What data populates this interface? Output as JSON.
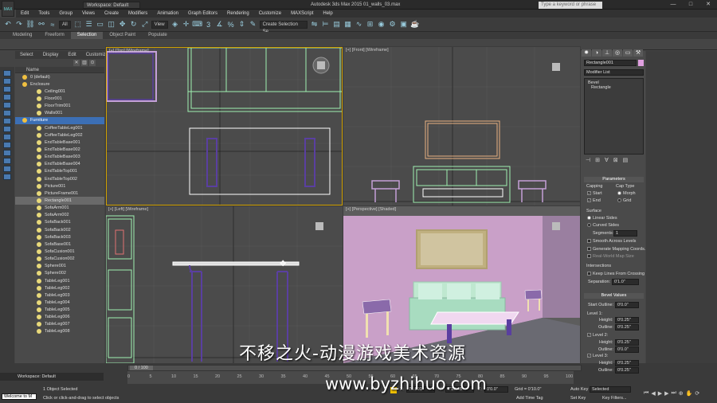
{
  "app": {
    "logo": "MAX",
    "workspace": "Workspace: Default",
    "title": "Autodesk 3ds Max 2015    01_walls_03.max",
    "search_placeholder": "Type a keyword or phrase"
  },
  "window_buttons": [
    "minimize-icon",
    "maximize-icon",
    "close-icon"
  ],
  "menu": [
    "Edit",
    "Tools",
    "Group",
    "Views",
    "Create",
    "Modifiers",
    "Animation",
    "Graph Editors",
    "Rendering",
    "Customize",
    "MAXScript",
    "Help"
  ],
  "toolbar": {
    "filter": "All",
    "selection_set": "Create Selection Se",
    "view_label": "View"
  },
  "ribbon": {
    "tabs": [
      "Modeling",
      "Freeform",
      "Selection",
      "Object Paint",
      "Populate"
    ],
    "active": "Selection"
  },
  "scene_explorer": {
    "menus": [
      "Select",
      "Display",
      "Edit",
      "Customize"
    ],
    "column_header": "Name",
    "items": [
      {
        "label": "0 (default)",
        "indent": 1,
        "state": "normal"
      },
      {
        "label": "Enclosure",
        "indent": 1,
        "state": "normal"
      },
      {
        "label": "Ceiling001",
        "indent": 3,
        "state": "normal"
      },
      {
        "label": "Floor001",
        "indent": 3,
        "state": "normal"
      },
      {
        "label": "FloorTrim001",
        "indent": 3,
        "state": "normal"
      },
      {
        "label": "Walls001",
        "indent": 3,
        "state": "normal"
      },
      {
        "label": "Furniture",
        "indent": 1,
        "state": "selected"
      },
      {
        "label": "CoffeeTableLeg001",
        "indent": 3,
        "state": "normal"
      },
      {
        "label": "CoffeeTableLeg002",
        "indent": 3,
        "state": "normal"
      },
      {
        "label": "EndTableBase001",
        "indent": 3,
        "state": "normal"
      },
      {
        "label": "EndTableBase002",
        "indent": 3,
        "state": "normal"
      },
      {
        "label": "EndTableBase003",
        "indent": 3,
        "state": "normal"
      },
      {
        "label": "EndTableBase004",
        "indent": 3,
        "state": "normal"
      },
      {
        "label": "EndTableTop001",
        "indent": 3,
        "state": "normal"
      },
      {
        "label": "EndTableTop002",
        "indent": 3,
        "state": "normal"
      },
      {
        "label": "Picture001",
        "indent": 3,
        "state": "normal"
      },
      {
        "label": "PictureFrame001",
        "indent": 3,
        "state": "normal"
      },
      {
        "label": "Rectangle001",
        "indent": 3,
        "state": "hover"
      },
      {
        "label": "SofaArm001",
        "indent": 3,
        "state": "normal"
      },
      {
        "label": "SofaArm002",
        "indent": 3,
        "state": "normal"
      },
      {
        "label": "SofaBack001",
        "indent": 3,
        "state": "normal"
      },
      {
        "label": "SofaBack002",
        "indent": 3,
        "state": "normal"
      },
      {
        "label": "SofaBack003",
        "indent": 3,
        "state": "normal"
      },
      {
        "label": "SofaBase001",
        "indent": 3,
        "state": "normal"
      },
      {
        "label": "SofaCusion001",
        "indent": 3,
        "state": "normal"
      },
      {
        "label": "SofaCusion002",
        "indent": 3,
        "state": "normal"
      },
      {
        "label": "Sphere001",
        "indent": 3,
        "state": "normal"
      },
      {
        "label": "Sphere002",
        "indent": 3,
        "state": "normal"
      },
      {
        "label": "TableLeg001",
        "indent": 3,
        "state": "normal"
      },
      {
        "label": "TableLeg002",
        "indent": 3,
        "state": "normal"
      },
      {
        "label": "TableLeg003",
        "indent": 3,
        "state": "normal"
      },
      {
        "label": "TableLeg004",
        "indent": 3,
        "state": "normal"
      },
      {
        "label": "TableLeg005",
        "indent": 3,
        "state": "normal"
      },
      {
        "label": "TableLeg006",
        "indent": 3,
        "state": "normal"
      },
      {
        "label": "TableLeg007",
        "indent": 3,
        "state": "normal"
      },
      {
        "label": "TableLeg008",
        "indent": 3,
        "state": "normal"
      }
    ],
    "workspace_footer": "Workspace: Default"
  },
  "viewports": {
    "top": "[+] [Top] [Wireframe]",
    "front": "[+] [Front] [Wireframe]",
    "left": "[+] [Left] [Wireframe]",
    "perspective": "[+] [Perspective] [Shaded]"
  },
  "command_panel": {
    "object_name": "Rectangle001",
    "modifier_list": "Modifier List",
    "stack": [
      "Bevel",
      "Rectangle"
    ],
    "parameters": {
      "title": "Parameters",
      "capping_label": "Capping",
      "cap_type_label": "Cap Type",
      "start": "Start",
      "end": "End",
      "morph": "Morph",
      "grid": "Grid",
      "surface_label": "Surface",
      "linear_sides": "Linear Sides",
      "curved_sides": "Curved Sides",
      "segments_label": "Segments:",
      "segments_value": "1",
      "smooth": "Smooth Across Levels",
      "gen_mapping": "Generate Mapping Coords.",
      "real_world": "Real-World Map Size",
      "intersections_label": "Intersections",
      "keep_lines": "Keep Lines From Crossing",
      "separation_label": "Separation:",
      "separation_value": "0'1.0\""
    },
    "bevel_values": {
      "title": "Bevel Values",
      "start_outline_label": "Start Outline:",
      "start_outline": "0'0.0\"",
      "level1": "Level 1:",
      "level1_height": "0'0.25\"",
      "level1_outline": "0'0.25\"",
      "level2": "Level 2:",
      "level2_height": "0'0.25\"",
      "level2_outline": "0'0.0\"",
      "level3": "Level 3:",
      "level3_height": "0'0.25\"",
      "level3_outline": "0'0.25\"",
      "height_label": "Height:",
      "outline_label": "Outline:"
    }
  },
  "timeline": {
    "frame_counter": "0 / 100",
    "ticks": [
      "0",
      "5",
      "10",
      "15",
      "20",
      "25",
      "30",
      "35",
      "40",
      "45",
      "50",
      "55",
      "60",
      "65",
      "70",
      "75",
      "80",
      "85",
      "90",
      "95",
      "100"
    ]
  },
  "status": {
    "maxscript": "Welcome to M",
    "selected": "1 Object Selected",
    "prompt": "Click or click-and-drag to select objects",
    "x_value": "76.691'",
    "y_value": "2'10.48'",
    "z_value": "0'0.0\"",
    "grid": "Grid = 0'10.0\"",
    "add_time_tag": "Add Time Tag",
    "auto_key": "Auto Key",
    "set_key": "Set Key",
    "selected_dropdown": "Selected",
    "key_filters": "Key Filters..."
  },
  "watermark": {
    "line1": "不移之火-动漫游戏美术资源",
    "line2": "www.byzhihuo.com"
  }
}
